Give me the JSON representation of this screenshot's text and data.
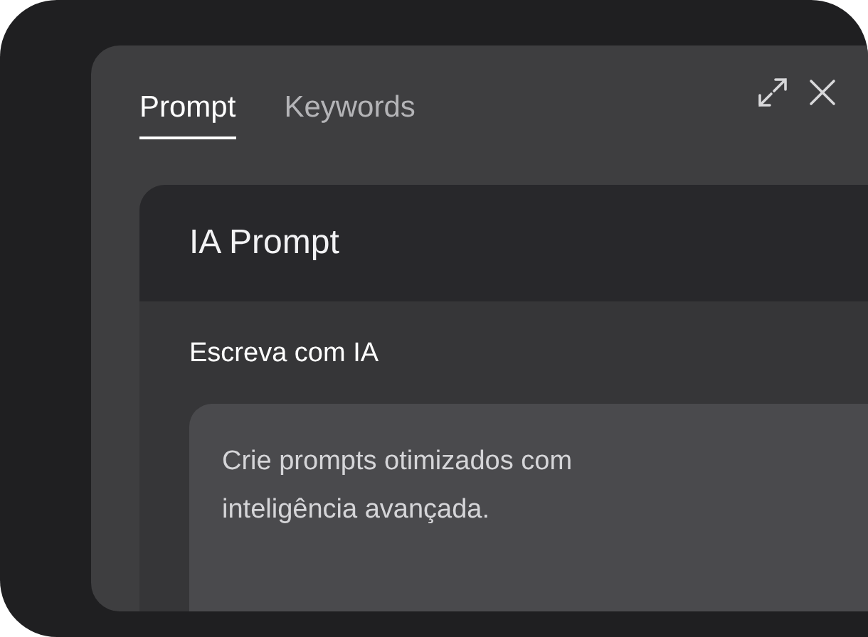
{
  "tabs": [
    {
      "label": "Prompt",
      "selected": true
    },
    {
      "label": "Keywords",
      "selected": false
    }
  ],
  "card": {
    "title": "IA Prompt",
    "section_label": "Escreva com IA",
    "prompt_field": {
      "value": "Crie prompts otimizados com inteligência avançada."
    }
  }
}
